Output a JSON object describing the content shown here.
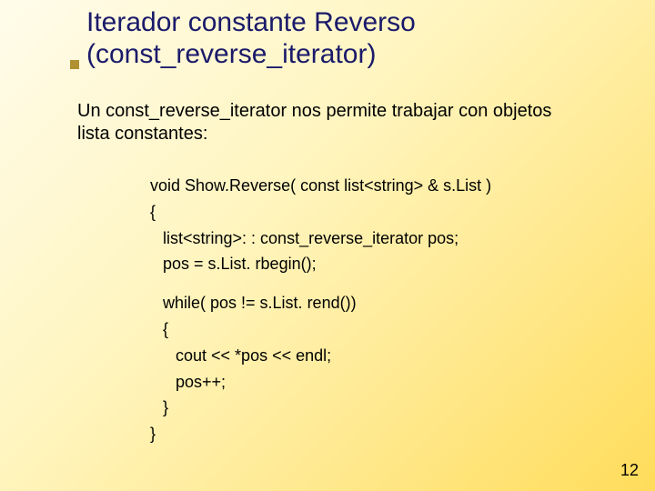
{
  "title": {
    "line1": "Iterador constante Reverso",
    "line2": "(const_reverse_iterator)"
  },
  "intro": "Un const_reverse_iterator nos permite trabajar con objetos lista constantes:",
  "code": {
    "l1": "void Show.Reverse( const list<string> & s.List )",
    "l2": "{",
    "l3": "list<string>: : const_reverse_iterator pos;",
    "l4": "pos = s.List. rbegin();",
    "l5": "while( pos != s.List. rend())",
    "l6": "{",
    "l7": "cout << *pos << endl;",
    "l8": "pos++;",
    "l9": "}",
    "l10": "}"
  },
  "page": "12"
}
